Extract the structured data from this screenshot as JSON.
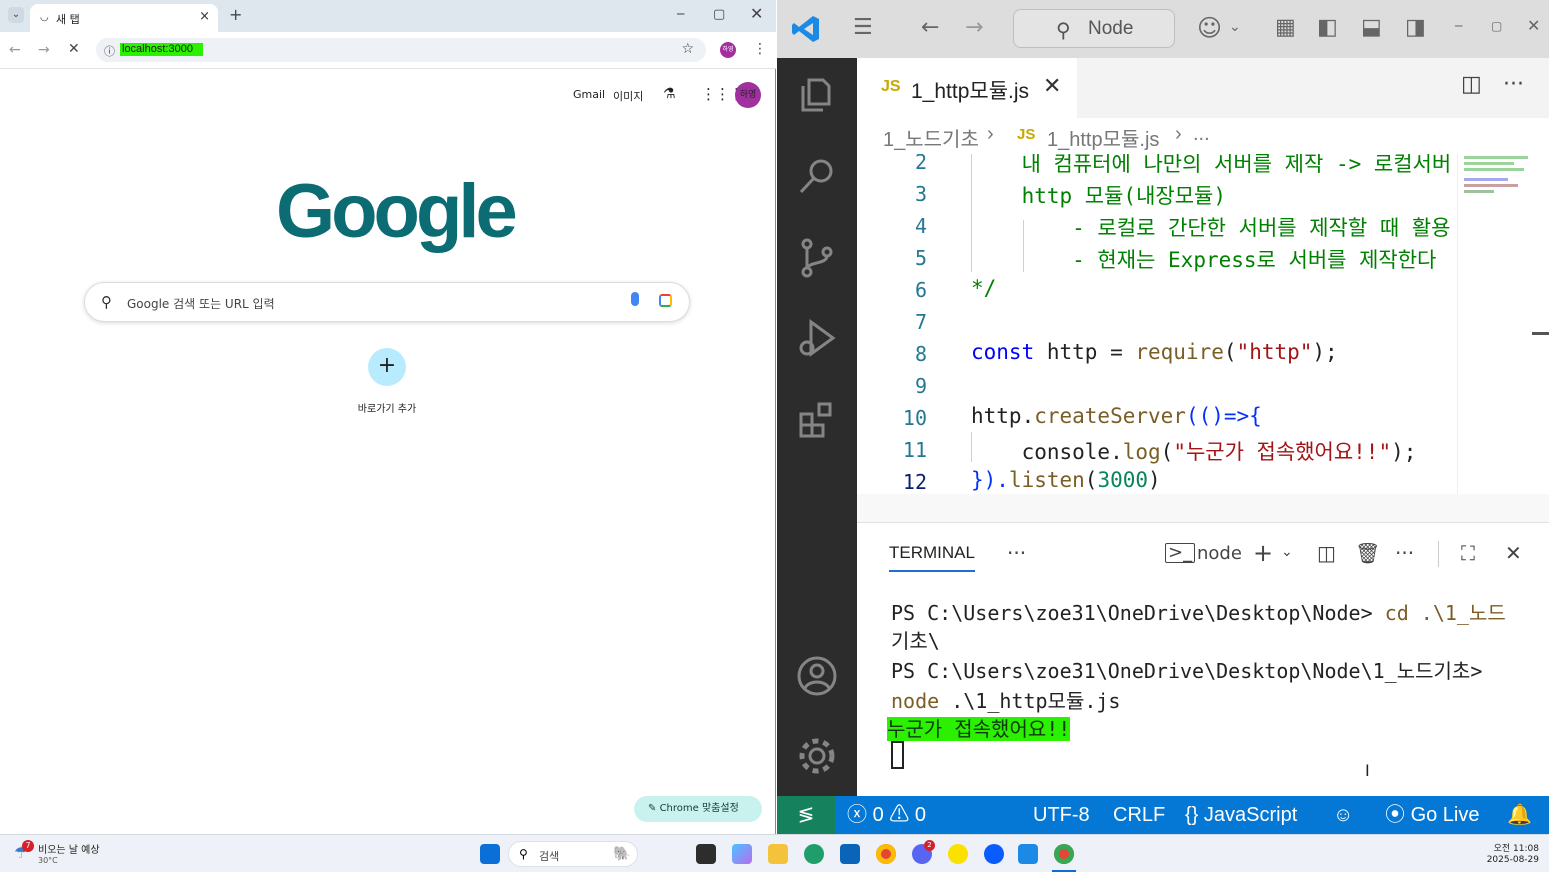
{
  "chrome": {
    "tab_title": "새 탭",
    "tab_favicon": "loading-icon",
    "new_tab_label": "+",
    "url": "localhost:3000",
    "profile_initials": "하영",
    "header_links": {
      "gmail": "Gmail",
      "images": "이미지"
    },
    "logo_text": "Google",
    "search_placeholder": "Google 검색 또는 URL 입력",
    "shortcut_label": "바로가기 추가",
    "shortcut_plus": "+",
    "customize_label": "Chrome 맞춤설정",
    "colors": {
      "url_highlight": "#2bf000",
      "logo": "#0b6c73",
      "avatar": "#a1309e"
    }
  },
  "vscode": {
    "command_center": "Node",
    "tab": {
      "lang_badge": "JS",
      "filename": "1_http모듈.js"
    },
    "breadcrumb": {
      "folder": "1_노드기초",
      "lang_badge": "JS",
      "file": "1_http모듈.js",
      "more": "..."
    },
    "line_numbers": [
      "2",
      "3",
      "4",
      "5",
      "6",
      "7",
      "8",
      "9",
      "10",
      "11",
      "12"
    ],
    "code": {
      "l2": "    내 컴퓨터에 나만의 서버를 제작 -> 로컬서버",
      "l3": "    http 모듈(내장모듈)",
      "l4": "        - 로컬로 간단한 서버를 제작할 때 활용",
      "l5": "        - 현재는 Express로 서버를 제작한다",
      "l6": "*/",
      "l8_kw": "const",
      "l8_var": " http = ",
      "l8_fn": "require",
      "l8_p1": "(",
      "l8_str": "\"http\"",
      "l8_p2": ");",
      "l10_a": "http.",
      "l10_fn": "createServer",
      "l10_b": "(()=>{",
      "l11_a": "    console.",
      "l11_fn": "log",
      "l11_p1": "(",
      "l11_str": "\"누군가 접속했어요!!\"",
      "l11_p2": ");",
      "l12_a": "}).",
      "l12_fn": "listen",
      "l12_p1": "(",
      "l12_num": "3000",
      "l12_p2": ")"
    },
    "panel": {
      "tab": "TERMINAL",
      "more": "···",
      "shell_name": "node"
    },
    "terminal": {
      "l1_prompt": "PS C:\\Users\\zoe31\\OneDrive\\Desktop\\Node> ",
      "l1_cmd": "cd .\\1_노드",
      "l2": "기초\\",
      "l3": "PS C:\\Users\\zoe31\\OneDrive\\Desktop\\Node\\1_노드기초>",
      "l4_cmd": "node",
      "l4_arg": " .\\1_http모듈.js",
      "output": "누군가 접속했어요!!"
    },
    "statusbar": {
      "errors": "0",
      "warnings": "0",
      "encoding": "UTF-8",
      "eol": "CRLF",
      "language": "JavaScript",
      "live": "Go Live"
    },
    "colors": {
      "statusbar": "#0478d4",
      "remote": "#16825d",
      "activitybar": "#2c2c2c"
    }
  },
  "taskbar": {
    "weather_badge": "7",
    "weather_text": "비오는 날 예상",
    "weather_temp": "30°C",
    "search_label": "검색",
    "clock_time": "오전 11:08",
    "clock_date": "2025-08-29",
    "discord_badge": "2"
  }
}
